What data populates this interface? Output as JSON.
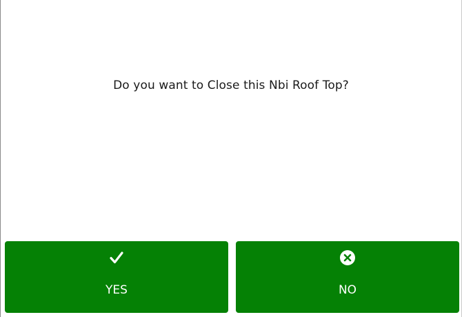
{
  "dialog": {
    "message": "Do you want to Close this Nbi Roof Top?",
    "buttons": {
      "yes": {
        "label": "YES",
        "icon": "checkmark-icon"
      },
      "no": {
        "label": "NO",
        "icon": "close-circle-icon"
      }
    },
    "colors": {
      "button_background": "#058105",
      "button_text": "#ffffff",
      "message_text": "#1a1a1a"
    }
  }
}
